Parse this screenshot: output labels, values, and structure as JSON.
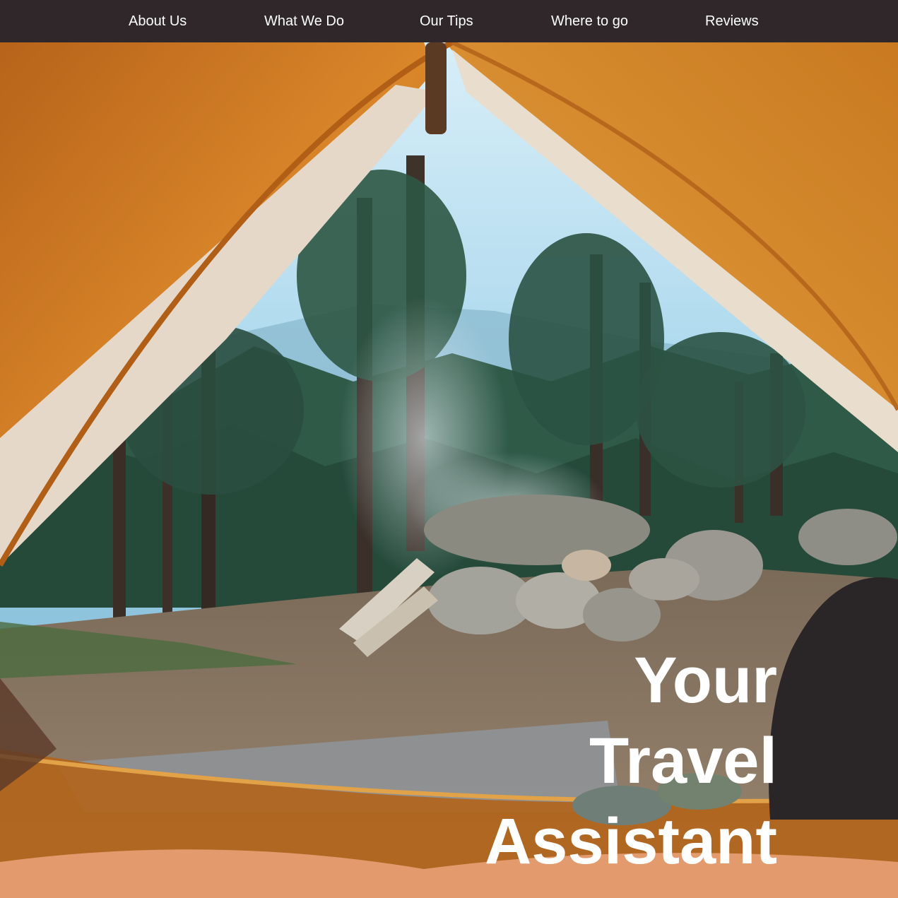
{
  "nav": {
    "items": [
      {
        "label": "About Us"
      },
      {
        "label": "What We Do"
      },
      {
        "label": "Our Tips"
      },
      {
        "label": "Where to go"
      },
      {
        "label": "Reviews"
      }
    ]
  },
  "hero": {
    "title_lines": [
      "Your",
      "Travel",
      "Assistant"
    ],
    "image_subject": "camping tent view of forest campsite"
  },
  "colors": {
    "nav_background": "#2f2729",
    "nav_text": "#ffffff",
    "tent_orange": "#c9731c",
    "tent_canvas": "#e6d8c8",
    "sky": "#bfe2f2"
  }
}
